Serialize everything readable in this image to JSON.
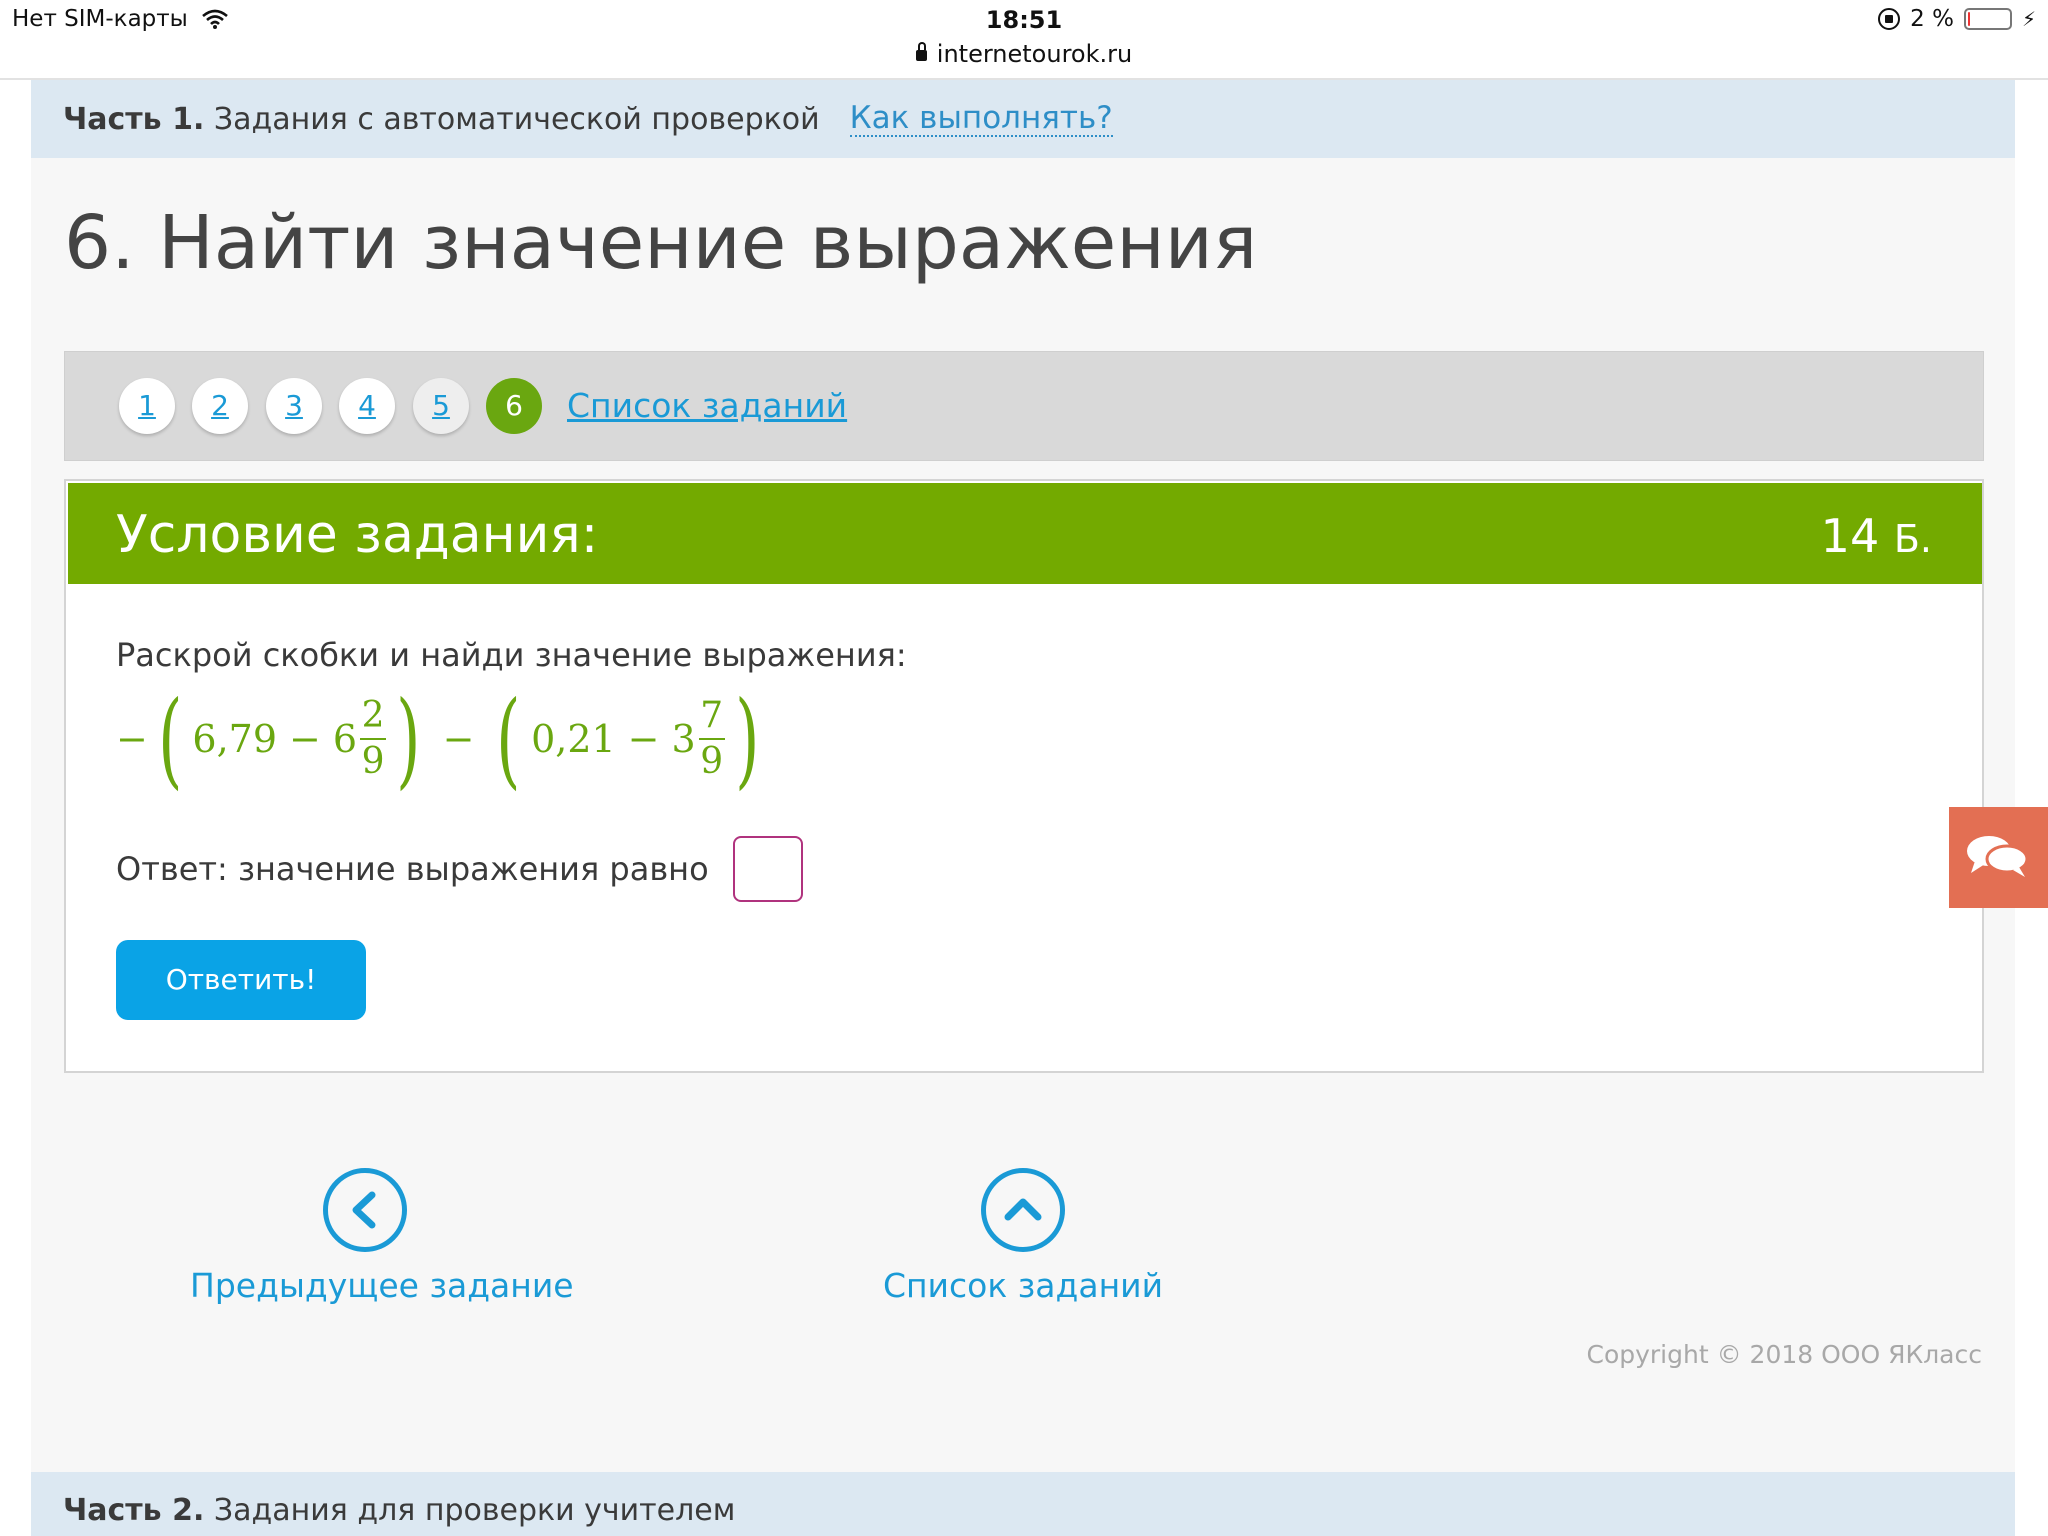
{
  "status_bar": {
    "carrier": "Нет SIM-карты",
    "time": "18:51",
    "url": "internetourok.ru",
    "battery": "2 %",
    "battery_level": 0.02
  },
  "part1": {
    "prefix": "Часть 1.",
    "title": "Задания с автоматической проверкой",
    "how_link": "Как выполнять?"
  },
  "page_title": "6. Найти значение выражения",
  "pager": {
    "items": [
      "1",
      "2",
      "3",
      "4",
      "5",
      "6"
    ],
    "active": "6",
    "list_link": "Список заданий"
  },
  "task": {
    "header": "Условие задания:",
    "points_value": "14",
    "points_unit": "Б.",
    "text": "Раскрой скобки и найди значение выражения:",
    "formula": {
      "minus1": "−",
      "a": "6,79",
      "minus2": "−",
      "w1": "6",
      "n1": "2",
      "d1": "9",
      "minus3": "−",
      "b": "0,21",
      "minus4": "−",
      "w2": "3",
      "n2": "7",
      "d2": "9"
    },
    "answer_label": "Ответ: значение выражения равно",
    "answer_value": "",
    "submit_label": "Ответить!"
  },
  "nav": {
    "prev_label": "Предыдущее задание",
    "list_label": "Список заданий"
  },
  "copyright": "Copyright © 2018 ООО ЯКласс",
  "part2": {
    "prefix": "Часть 2.",
    "title": "Задания для проверки учителем"
  },
  "colors": {
    "accent_green": "#73aa00",
    "link_blue": "#1a9ad6",
    "button_blue": "#0aa3e6",
    "chat_tab": "#e36f53",
    "input_border": "#b0337e"
  }
}
